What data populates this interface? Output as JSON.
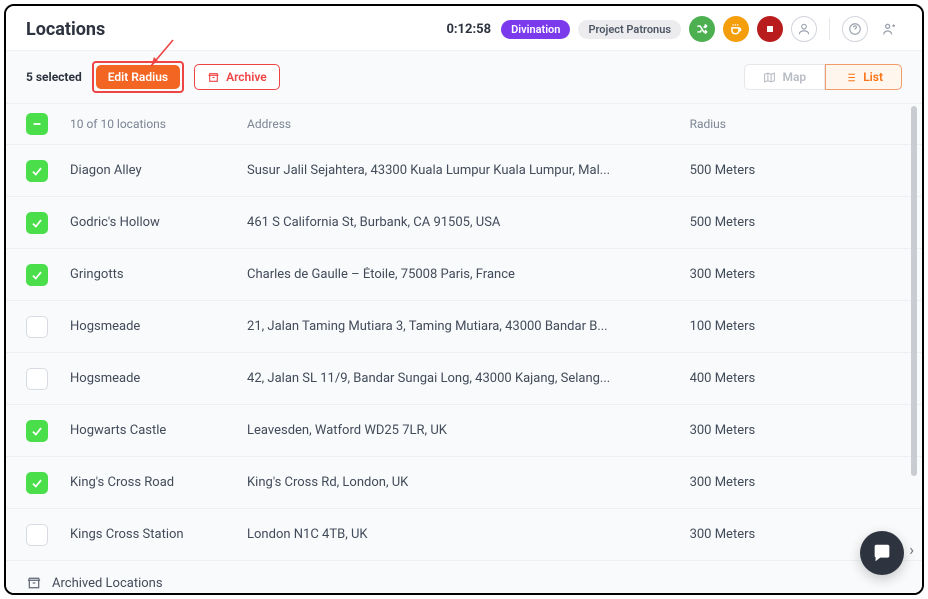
{
  "header": {
    "title": "Locations",
    "timer": "0:12:58",
    "pill1": "Divination",
    "pill2": "Project Patronus"
  },
  "toolbar": {
    "selected_label": "5 selected",
    "edit_radius_label": "Edit Radius",
    "archive_label": "Archive",
    "map_label": "Map",
    "list_label": "List"
  },
  "table": {
    "header_count": "10 of 10 locations",
    "header_address": "Address",
    "header_radius": "Radius",
    "rows": [
      {
        "checked": true,
        "name": "Diagon Alley",
        "address": "Susur Jalil Sejahtera, 43300 Kuala Lumpur Kuala Lumpur, Mal...",
        "radius": "500 Meters"
      },
      {
        "checked": true,
        "name": "Godric's Hollow",
        "address": "461 S California St, Burbank, CA 91505, USA",
        "radius": "500 Meters"
      },
      {
        "checked": true,
        "name": "Gringotts",
        "address": "Charles de Gaulle – Étoile, 75008 Paris, France",
        "radius": "300 Meters"
      },
      {
        "checked": false,
        "name": "Hogsmeade",
        "address": "21, Jalan Taming Mutiara 3, Taming Mutiara, 43000 Bandar B...",
        "radius": "100 Meters"
      },
      {
        "checked": false,
        "name": "Hogsmeade",
        "address": "42, Jalan SL 11/9, Bandar Sungai Long, 43000 Kajang, Selang...",
        "radius": "400 Meters"
      },
      {
        "checked": true,
        "name": "Hogwarts Castle",
        "address": "Leavesden, Watford WD25 7LR, UK",
        "radius": "300 Meters"
      },
      {
        "checked": true,
        "name": "King's Cross Road",
        "address": "King's Cross Rd, London, UK",
        "radius": "300 Meters"
      },
      {
        "checked": false,
        "name": "Kings Cross Station",
        "address": "London N1C 4TB, UK",
        "radius": "300 Meters"
      }
    ]
  },
  "archived_label": "Archived Locations",
  "colors": {
    "accent_orange": "#f26522",
    "accent_red": "#ef4444",
    "accent_green": "#4ade4a",
    "accent_purple": "#7c3aed"
  }
}
